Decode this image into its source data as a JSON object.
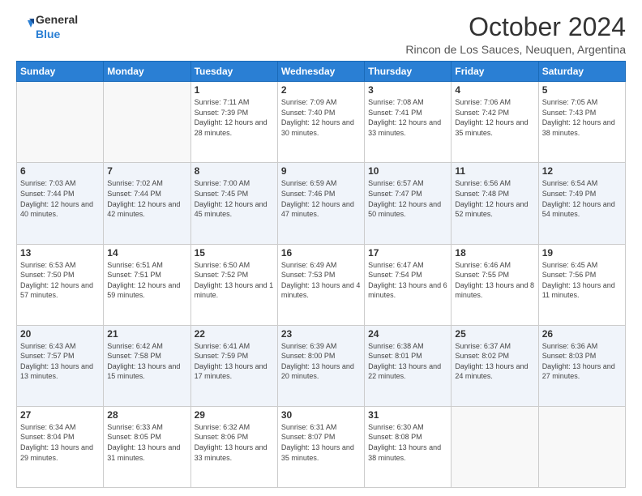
{
  "header": {
    "logo_general": "General",
    "logo_blue": "Blue",
    "month_title": "October 2024",
    "subtitle": "Rincon de Los Sauces, Neuquen, Argentina"
  },
  "days_of_week": [
    "Sunday",
    "Monday",
    "Tuesday",
    "Wednesday",
    "Thursday",
    "Friday",
    "Saturday"
  ],
  "weeks": [
    [
      {
        "day": "",
        "info": ""
      },
      {
        "day": "",
        "info": ""
      },
      {
        "day": "1",
        "info": "Sunrise: 7:11 AM\nSunset: 7:39 PM\nDaylight: 12 hours and 28 minutes."
      },
      {
        "day": "2",
        "info": "Sunrise: 7:09 AM\nSunset: 7:40 PM\nDaylight: 12 hours and 30 minutes."
      },
      {
        "day": "3",
        "info": "Sunrise: 7:08 AM\nSunset: 7:41 PM\nDaylight: 12 hours and 33 minutes."
      },
      {
        "day": "4",
        "info": "Sunrise: 7:06 AM\nSunset: 7:42 PM\nDaylight: 12 hours and 35 minutes."
      },
      {
        "day": "5",
        "info": "Sunrise: 7:05 AM\nSunset: 7:43 PM\nDaylight: 12 hours and 38 minutes."
      }
    ],
    [
      {
        "day": "6",
        "info": "Sunrise: 7:03 AM\nSunset: 7:44 PM\nDaylight: 12 hours and 40 minutes."
      },
      {
        "day": "7",
        "info": "Sunrise: 7:02 AM\nSunset: 7:44 PM\nDaylight: 12 hours and 42 minutes."
      },
      {
        "day": "8",
        "info": "Sunrise: 7:00 AM\nSunset: 7:45 PM\nDaylight: 12 hours and 45 minutes."
      },
      {
        "day": "9",
        "info": "Sunrise: 6:59 AM\nSunset: 7:46 PM\nDaylight: 12 hours and 47 minutes."
      },
      {
        "day": "10",
        "info": "Sunrise: 6:57 AM\nSunset: 7:47 PM\nDaylight: 12 hours and 50 minutes."
      },
      {
        "day": "11",
        "info": "Sunrise: 6:56 AM\nSunset: 7:48 PM\nDaylight: 12 hours and 52 minutes."
      },
      {
        "day": "12",
        "info": "Sunrise: 6:54 AM\nSunset: 7:49 PM\nDaylight: 12 hours and 54 minutes."
      }
    ],
    [
      {
        "day": "13",
        "info": "Sunrise: 6:53 AM\nSunset: 7:50 PM\nDaylight: 12 hours and 57 minutes."
      },
      {
        "day": "14",
        "info": "Sunrise: 6:51 AM\nSunset: 7:51 PM\nDaylight: 12 hours and 59 minutes."
      },
      {
        "day": "15",
        "info": "Sunrise: 6:50 AM\nSunset: 7:52 PM\nDaylight: 13 hours and 1 minute."
      },
      {
        "day": "16",
        "info": "Sunrise: 6:49 AM\nSunset: 7:53 PM\nDaylight: 13 hours and 4 minutes."
      },
      {
        "day": "17",
        "info": "Sunrise: 6:47 AM\nSunset: 7:54 PM\nDaylight: 13 hours and 6 minutes."
      },
      {
        "day": "18",
        "info": "Sunrise: 6:46 AM\nSunset: 7:55 PM\nDaylight: 13 hours and 8 minutes."
      },
      {
        "day": "19",
        "info": "Sunrise: 6:45 AM\nSunset: 7:56 PM\nDaylight: 13 hours and 11 minutes."
      }
    ],
    [
      {
        "day": "20",
        "info": "Sunrise: 6:43 AM\nSunset: 7:57 PM\nDaylight: 13 hours and 13 minutes."
      },
      {
        "day": "21",
        "info": "Sunrise: 6:42 AM\nSunset: 7:58 PM\nDaylight: 13 hours and 15 minutes."
      },
      {
        "day": "22",
        "info": "Sunrise: 6:41 AM\nSunset: 7:59 PM\nDaylight: 13 hours and 17 minutes."
      },
      {
        "day": "23",
        "info": "Sunrise: 6:39 AM\nSunset: 8:00 PM\nDaylight: 13 hours and 20 minutes."
      },
      {
        "day": "24",
        "info": "Sunrise: 6:38 AM\nSunset: 8:01 PM\nDaylight: 13 hours and 22 minutes."
      },
      {
        "day": "25",
        "info": "Sunrise: 6:37 AM\nSunset: 8:02 PM\nDaylight: 13 hours and 24 minutes."
      },
      {
        "day": "26",
        "info": "Sunrise: 6:36 AM\nSunset: 8:03 PM\nDaylight: 13 hours and 27 minutes."
      }
    ],
    [
      {
        "day": "27",
        "info": "Sunrise: 6:34 AM\nSunset: 8:04 PM\nDaylight: 13 hours and 29 minutes."
      },
      {
        "day": "28",
        "info": "Sunrise: 6:33 AM\nSunset: 8:05 PM\nDaylight: 13 hours and 31 minutes."
      },
      {
        "day": "29",
        "info": "Sunrise: 6:32 AM\nSunset: 8:06 PM\nDaylight: 13 hours and 33 minutes."
      },
      {
        "day": "30",
        "info": "Sunrise: 6:31 AM\nSunset: 8:07 PM\nDaylight: 13 hours and 35 minutes."
      },
      {
        "day": "31",
        "info": "Sunrise: 6:30 AM\nSunset: 8:08 PM\nDaylight: 13 hours and 38 minutes."
      },
      {
        "day": "",
        "info": ""
      },
      {
        "day": "",
        "info": ""
      }
    ]
  ]
}
